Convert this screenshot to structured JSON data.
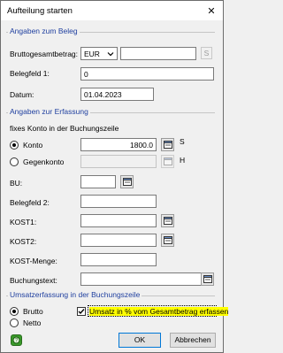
{
  "window": {
    "title": "Aufteilung starten",
    "close_label": "✕"
  },
  "sections": {
    "beleg": "Angaben zum Beleg",
    "erfassung": "Angaben zur Erfassung",
    "umsatz": "Umsatzerfassung in der Buchungszeile"
  },
  "beleg": {
    "bruttogesamtbetrag_label": "Bruttogesamtbetrag:",
    "currency": "EUR",
    "amount": "",
    "amount_suffix": "S",
    "belegfeld1_label": "Belegfeld 1:",
    "belegfeld1_value": "0",
    "datum_label": "Datum:",
    "datum_value": "01.04.2023"
  },
  "erfassung": {
    "fixes_konto_label": "fixes Konto in der Buchungszeile",
    "konto_label": "Konto",
    "konto_value": "1800.0",
    "konto_suffix": "S",
    "gegenkonto_label": "Gegenkonto",
    "gegenkonto_value": "",
    "gegenkonto_suffix": "H",
    "bu_label": "BU:",
    "bu_value": "",
    "belegfeld2_label": "Belegfeld 2:",
    "belegfeld2_value": "",
    "kost1_label": "KOST1:",
    "kost1_value": "",
    "kost2_label": "KOST2:",
    "kost2_value": "",
    "kostmenge_label": "KOST-Menge:",
    "kostmenge_value": "",
    "buchungstext_label": "Buchungstext:",
    "buchungstext_value": ""
  },
  "umsatz": {
    "brutto_label": "Brutto",
    "netto_label": "Netto",
    "checkbox_label": "Umsatz in % vom Gesamtbetrag erfassen",
    "checkbox_checked": true
  },
  "footer": {
    "ok_label": "OK",
    "cancel_label": "Abbrechen"
  },
  "colors": {
    "section_heading": "#1f3f9f",
    "highlight": "#ffff00",
    "help_icon": "#3a9a2a"
  }
}
